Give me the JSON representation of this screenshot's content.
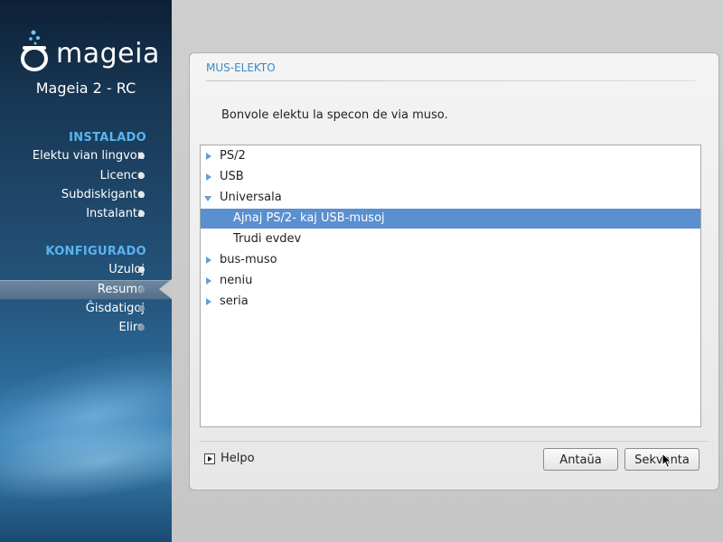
{
  "sidebar": {
    "logo_text": "mageia",
    "subtitle": "Mageia 2 - RC",
    "sections": [
      {
        "title": "INSTALADO",
        "steps": [
          "Elektu vian lingvon",
          "Licenco",
          "Subdiskigante",
          "Instalanta"
        ]
      },
      {
        "title": "KONFIGURADO",
        "steps": [
          "Uzuloj",
          "Resumo",
          "Ĝisdatigoj",
          "Eliro"
        ]
      }
    ],
    "active_step": "Resumo"
  },
  "dialog": {
    "title": "MUS-ELEKTO",
    "prompt": "Bonvole elektu la specon de via muso.",
    "tree": [
      {
        "label": "PS/2",
        "level": 0,
        "expander": "collapsed"
      },
      {
        "label": "USB",
        "level": 0,
        "expander": "collapsed"
      },
      {
        "label": "Universala",
        "level": 0,
        "expander": "expanded"
      },
      {
        "label": "Ajnaj PS/2- kaj USB-musoj",
        "level": 1,
        "expander": "none",
        "selected": true
      },
      {
        "label": "Trudi evdev",
        "level": 1,
        "expander": "none"
      },
      {
        "label": "bus-muso",
        "level": 0,
        "expander": "collapsed"
      },
      {
        "label": "neniu",
        "level": 0,
        "expander": "collapsed"
      },
      {
        "label": "seria",
        "level": 0,
        "expander": "collapsed"
      }
    ],
    "help_label": "Helpo",
    "prev_label": "Antaŭa",
    "next_label": "Sekvanta"
  },
  "colors": {
    "accent": "#5ab4ee",
    "selection": "#5a8fd0",
    "title": "#3a8ac6"
  }
}
